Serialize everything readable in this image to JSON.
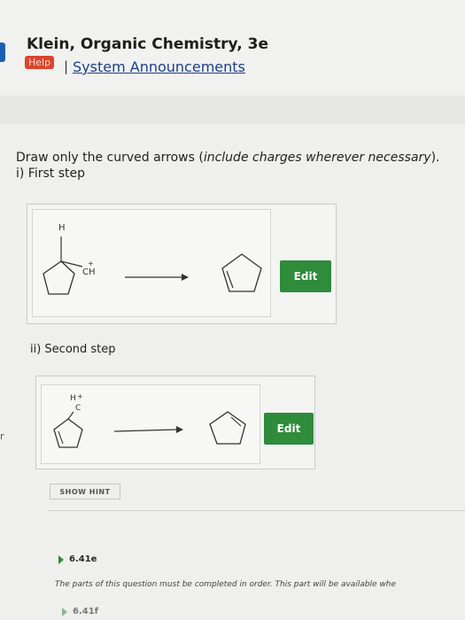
{
  "header": {
    "book_title": "Klein, Organic Chemistry, 3e",
    "help_label": "Help",
    "separator": "|",
    "announcements_link": "System Announcements"
  },
  "question": {
    "instruction_prefix": "Draw only the curved arrows (",
    "instruction_italic": "include charges wherever necessary",
    "instruction_suffix": ").",
    "step1_label": "i) First step",
    "step2_label": "ii) Second step",
    "edit_label": "Edit",
    "molecule_labels": {
      "h": "H",
      "ch_plus": "CH",
      "plus": "+",
      "h_plus": "H",
      "c": "C"
    }
  },
  "hint_button": "SHOW HINT",
  "parts": [
    {
      "id": "6.41e"
    },
    {
      "id": "6.41f"
    }
  ],
  "order_note": "The parts of this question must be completed in order. This part will be available whe",
  "edge_mark": "r",
  "colors": {
    "edit_button": "#2e8c3b",
    "help_badge": "#d9452c",
    "link": "#1b3f8a"
  }
}
